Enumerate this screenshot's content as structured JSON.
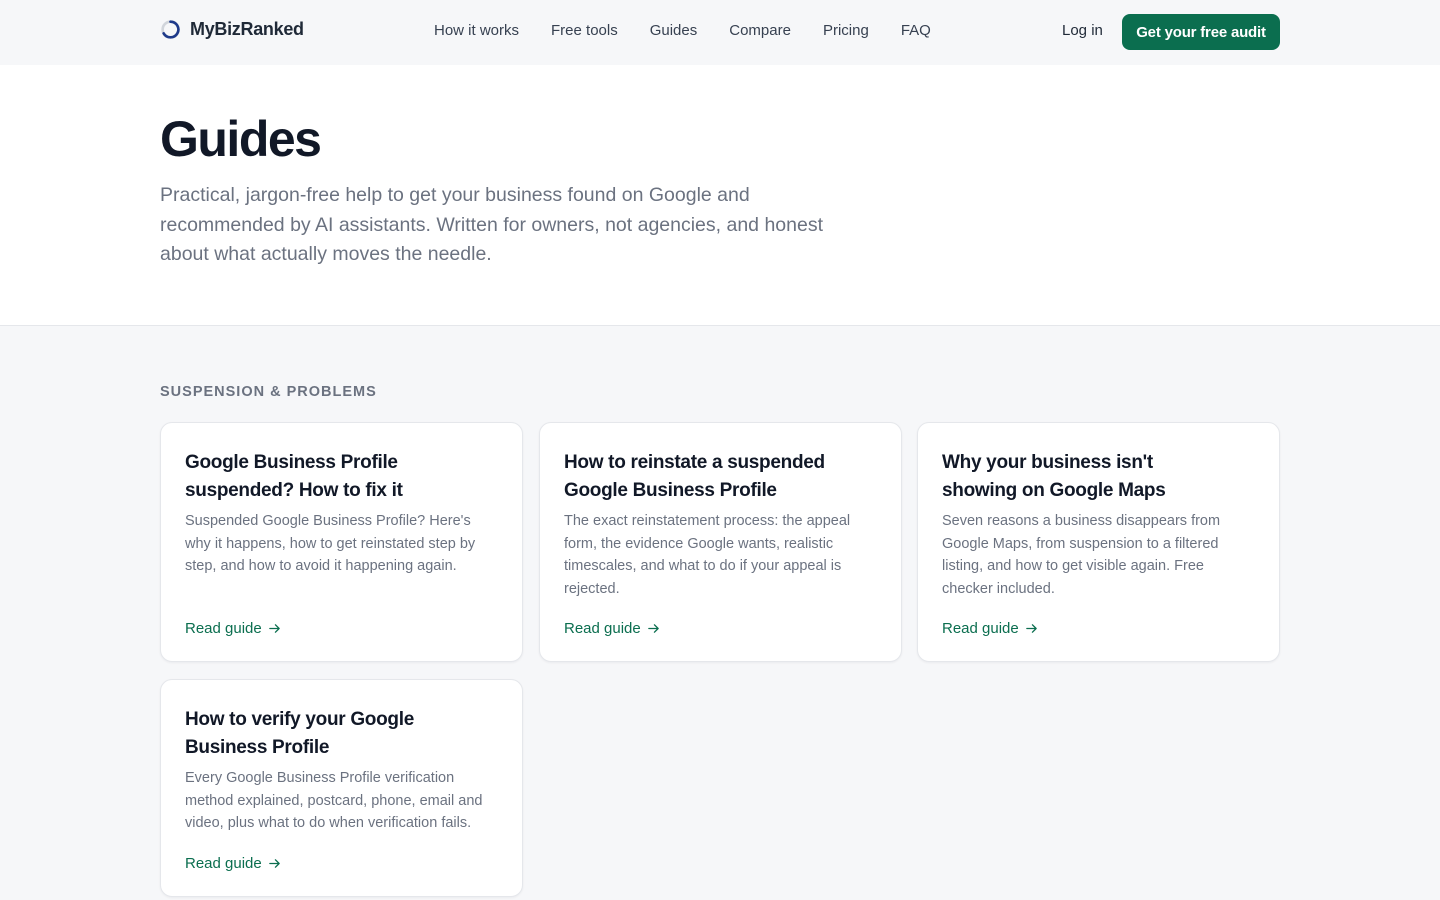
{
  "brand": {
    "name": "MyBizRanked"
  },
  "nav": {
    "items": [
      "How it works",
      "Free tools",
      "Guides",
      "Compare",
      "Pricing",
      "FAQ"
    ],
    "login": "Log in",
    "cta": "Get your free audit"
  },
  "hero": {
    "title": "Guides",
    "subtitle": "Practical, jargon-free help to get your business found on Google and recommended by AI assistants. Written for owners, not agencies, and honest about what actually moves the needle."
  },
  "section": {
    "label": "SUSPENSION & PROBLEMS",
    "cards": [
      {
        "title": "Google Business Profile suspended? How to fix it",
        "desc": "Suspended Google Business Profile? Here's why it happens, how to get reinstated step by step, and how to avoid it happening again.",
        "link": "Read guide"
      },
      {
        "title": "How to reinstate a suspended Google Business Profile",
        "desc": "The exact reinstatement process: the appeal form, the evidence Google wants, realistic timescales, and what to do if your appeal is rejected.",
        "link": "Read guide"
      },
      {
        "title": "Why your business isn't showing on Google Maps",
        "desc": "Seven reasons a business disappears from Google Maps, from suspension to a filtered listing, and how to get visible again. Free checker included.",
        "link": "Read guide"
      },
      {
        "title": "How to verify your Google Business Profile",
        "desc": "Every Google Business Profile verification method explained, postcard, phone, email and video, plus what to do when verification fails.",
        "link": "Read guide"
      }
    ]
  },
  "colors": {
    "accent": "#0b6e4f",
    "logo_ring": "#1e3a8a",
    "page_bg": "#f6f7f9"
  },
  "icons": {
    "logo": "ring-logo-icon",
    "link_arrow": "arrow-right-icon"
  }
}
